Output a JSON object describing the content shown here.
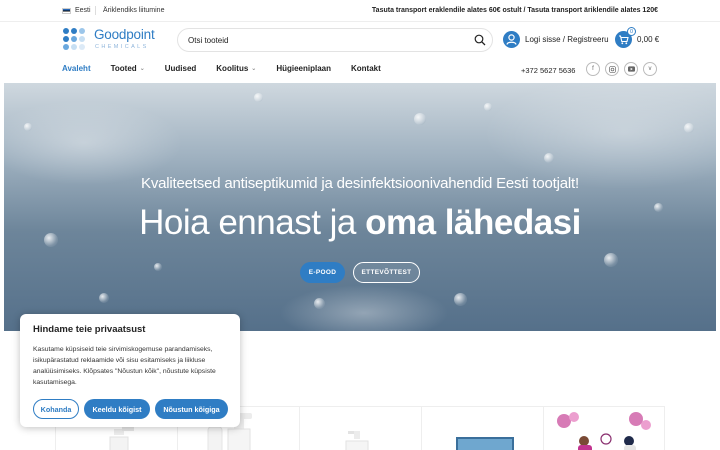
{
  "topbar": {
    "language": "Eesti",
    "business_link": "Äriklendiks liitumine",
    "shipping_notice": "Tasuta transport eraklendile alates 60€ ostult / Tasuta transport äriklendile alates 120€"
  },
  "header": {
    "logo_name": "Goodpoint",
    "logo_sub": "CHEMICALS",
    "search_placeholder": "Otsi tooteid",
    "login_label": "Logi sisse / Registreeru",
    "cart_count": "0",
    "cart_total": "0,00 €"
  },
  "nav": {
    "items": [
      {
        "label": "Avaleht",
        "active": true,
        "dropdown": false
      },
      {
        "label": "Tooted",
        "active": false,
        "dropdown": true
      },
      {
        "label": "Uudised",
        "active": false,
        "dropdown": false
      },
      {
        "label": "Koolitus",
        "active": false,
        "dropdown": true
      },
      {
        "label": "Hügieeniplaan",
        "active": false,
        "dropdown": false
      },
      {
        "label": "Kontakt",
        "active": false,
        "dropdown": false
      }
    ],
    "phone": "+372 5627 5636",
    "socials": [
      "facebook-icon",
      "instagram-icon",
      "youtube-icon",
      "vimeo-icon"
    ]
  },
  "hero": {
    "subtitle": "Kvaliteetsed antiseptikumid ja desinfektsioonivahendid Eesti tootjalt!",
    "title_light": "Hoia ennast ja ",
    "title_bold": "oma lähedasi",
    "btn_primary": "E-POOD",
    "btn_secondary": "ETTEVÕTTEST"
  },
  "cookie": {
    "title": "Hindame teie privaatsust",
    "text": "Kasutame küpsiseid teie sirvimiskogemuse parandamiseks, isikupärastatud reklaamide või sisu esitamiseks ja liikluse analüüsimiseks. Klõpsates \"Nõustun kõik\", nõustute küpsiste kasutamisega.",
    "btn_customize": "Kohanda",
    "btn_reject": "Keeldu kõigist",
    "btn_accept": "Nõustun kõigiga"
  },
  "colors": {
    "accent": "#2f7dc4",
    "text": "#222222"
  }
}
